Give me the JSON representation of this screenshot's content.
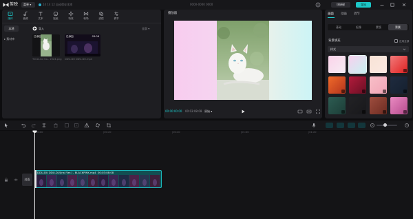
{
  "app": {
    "name": "剪映",
    "menu_label": "菜单",
    "project_info": "14 14 12 自动保存本地",
    "window_title": "0000-0000 0000",
    "shortcut_label": "快捷键",
    "export_label": "导出"
  },
  "toolbar_tabs": [
    {
      "label": "媒体",
      "icon": "media-icon",
      "active": true
    },
    {
      "label": "音频",
      "icon": "audio-icon",
      "active": false
    },
    {
      "label": "文本",
      "icon": "text-icon",
      "active": false
    },
    {
      "label": "贴纸",
      "icon": "sticker-icon",
      "active": false
    },
    {
      "label": "特效",
      "icon": "effects-icon",
      "active": false
    },
    {
      "label": "转场",
      "icon": "transition-icon",
      "active": false
    },
    {
      "label": "滤镜",
      "icon": "filter-icon",
      "active": false
    },
    {
      "label": "调节",
      "icon": "adjust-icon",
      "active": false
    }
  ],
  "media": {
    "side_local": "本地",
    "side_cloud": "素材库",
    "import_label": "导入",
    "sort_label": "全部",
    "items": [
      {
        "badge": "已添加",
        "duration": "",
        "name": "TimeLine Ka.. 2024.png",
        "kind": "cat"
      },
      {
        "badge": "已添加",
        "duration": "03:08",
        "name": "DDU-DU DDU-DU.mp4",
        "kind": "video"
      }
    ]
  },
  "player": {
    "title": "播放器",
    "time_current": "00:00:00:00",
    "time_total": "00:03:08:08",
    "ratio_label": "原始"
  },
  "properties": {
    "tabs": [
      {
        "label": "画面",
        "active": true
      },
      {
        "label": "动画",
        "active": false
      },
      {
        "label": "调节",
        "active": false
      }
    ],
    "subtabs": [
      {
        "label": "基础",
        "active": false
      },
      {
        "label": "抠像",
        "active": false
      },
      {
        "label": "蒙版",
        "active": false
      },
      {
        "label": "背景",
        "active": true
      }
    ],
    "bg_fill_label": "背景填充",
    "apply_all_label": "应用全部",
    "style_select": "样式",
    "swatches": [
      {
        "name": "pink-gradient",
        "colors": [
          "#fbd3ea",
          "#f6ecf3"
        ],
        "download": false,
        "selected": false
      },
      {
        "name": "pink-mint-gradient",
        "colors": [
          "#f7d1ee",
          "#c8f2f2"
        ],
        "download": false,
        "selected": true
      },
      {
        "name": "peach-gradient",
        "colors": [
          "#f8e3d6",
          "#fbe9e2"
        ],
        "download": false,
        "selected": false
      },
      {
        "name": "red-gradient",
        "colors": [
          "#f27a7a",
          "#e02222"
        ],
        "download": true,
        "selected": false
      },
      {
        "name": "orange-sunburst",
        "colors": [
          "#ef6a2a",
          "#b4341d"
        ],
        "download": true,
        "selected": false
      },
      {
        "name": "crimson-sparkle",
        "colors": [
          "#b21b3b",
          "#6a0f24"
        ],
        "download": true,
        "selected": false
      },
      {
        "name": "pink-flowers",
        "colors": [
          "#f8bfc8",
          "#f1a5b6"
        ],
        "download": true,
        "selected": false
      },
      {
        "name": "navy-dark",
        "colors": [
          "#1f2b3f",
          "#15202f"
        ],
        "download": true,
        "selected": false
      },
      {
        "name": "teal-dark",
        "colors": [
          "#2d5c52",
          "#1c3d37"
        ],
        "download": true,
        "selected": false
      },
      {
        "name": "charcoal",
        "colors": [
          "#222225",
          "#18181b"
        ],
        "download": true,
        "selected": false
      },
      {
        "name": "red-brick",
        "colors": [
          "#9e4d3e",
          "#6d2c22"
        ],
        "download": true,
        "selected": false
      },
      {
        "name": "pink-glitter",
        "colors": [
          "#e98ac1",
          "#b64b8e"
        ],
        "download": true,
        "selected": false
      }
    ]
  },
  "timeline": {
    "ticks": [
      "00:00",
      "|00:20",
      "|00:40",
      "|01:00",
      "|01:20"
    ],
    "cover_label": "封面",
    "clip_name": "DDU-DU DDU-DU(Inst Ver.) - BLACKPINK.mp4",
    "clip_duration": "00:03:08:08"
  },
  "colors": {
    "accent": "#1ccfd0",
    "panel": "#1e1e22",
    "background": "#0d0d0f"
  }
}
